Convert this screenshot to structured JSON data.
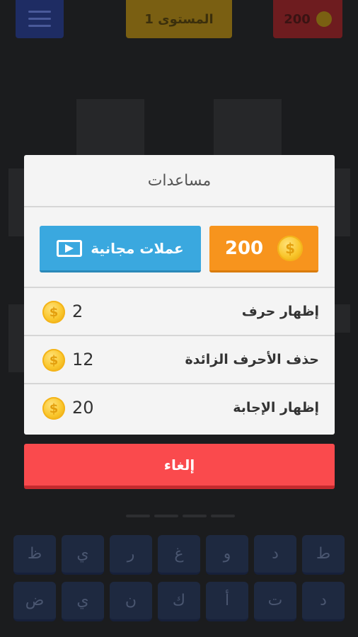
{
  "header": {
    "level_label": "المستوى 1",
    "coins": "200"
  },
  "dialog": {
    "title": "مساعدات",
    "balance": "200",
    "free_coins_label": "عملات مجانية",
    "helps": [
      {
        "label": "إظهار حرف",
        "cost": "2"
      },
      {
        "label": "حذف الأحرف الزائدة",
        "cost": "12"
      },
      {
        "label": "إظهار الإجابة",
        "cost": "20"
      }
    ],
    "cancel_label": "إلغاء"
  },
  "keyboard": {
    "row1": [
      "ط",
      "د",
      "و",
      "غ",
      "ر",
      "ي",
      "ظ"
    ],
    "row2": [
      "د",
      "ت",
      "أ",
      "ك",
      "ن",
      "ي",
      "ض"
    ]
  },
  "icons": {
    "menu": "menu-icon",
    "coin": "coin-icon",
    "video": "video-play-icon"
  },
  "colors": {
    "free_coins_button": "#3aa8df",
    "balance_box": "#f7941d",
    "cancel_button": "#fa4a4d",
    "coin": "#f9c52a"
  }
}
